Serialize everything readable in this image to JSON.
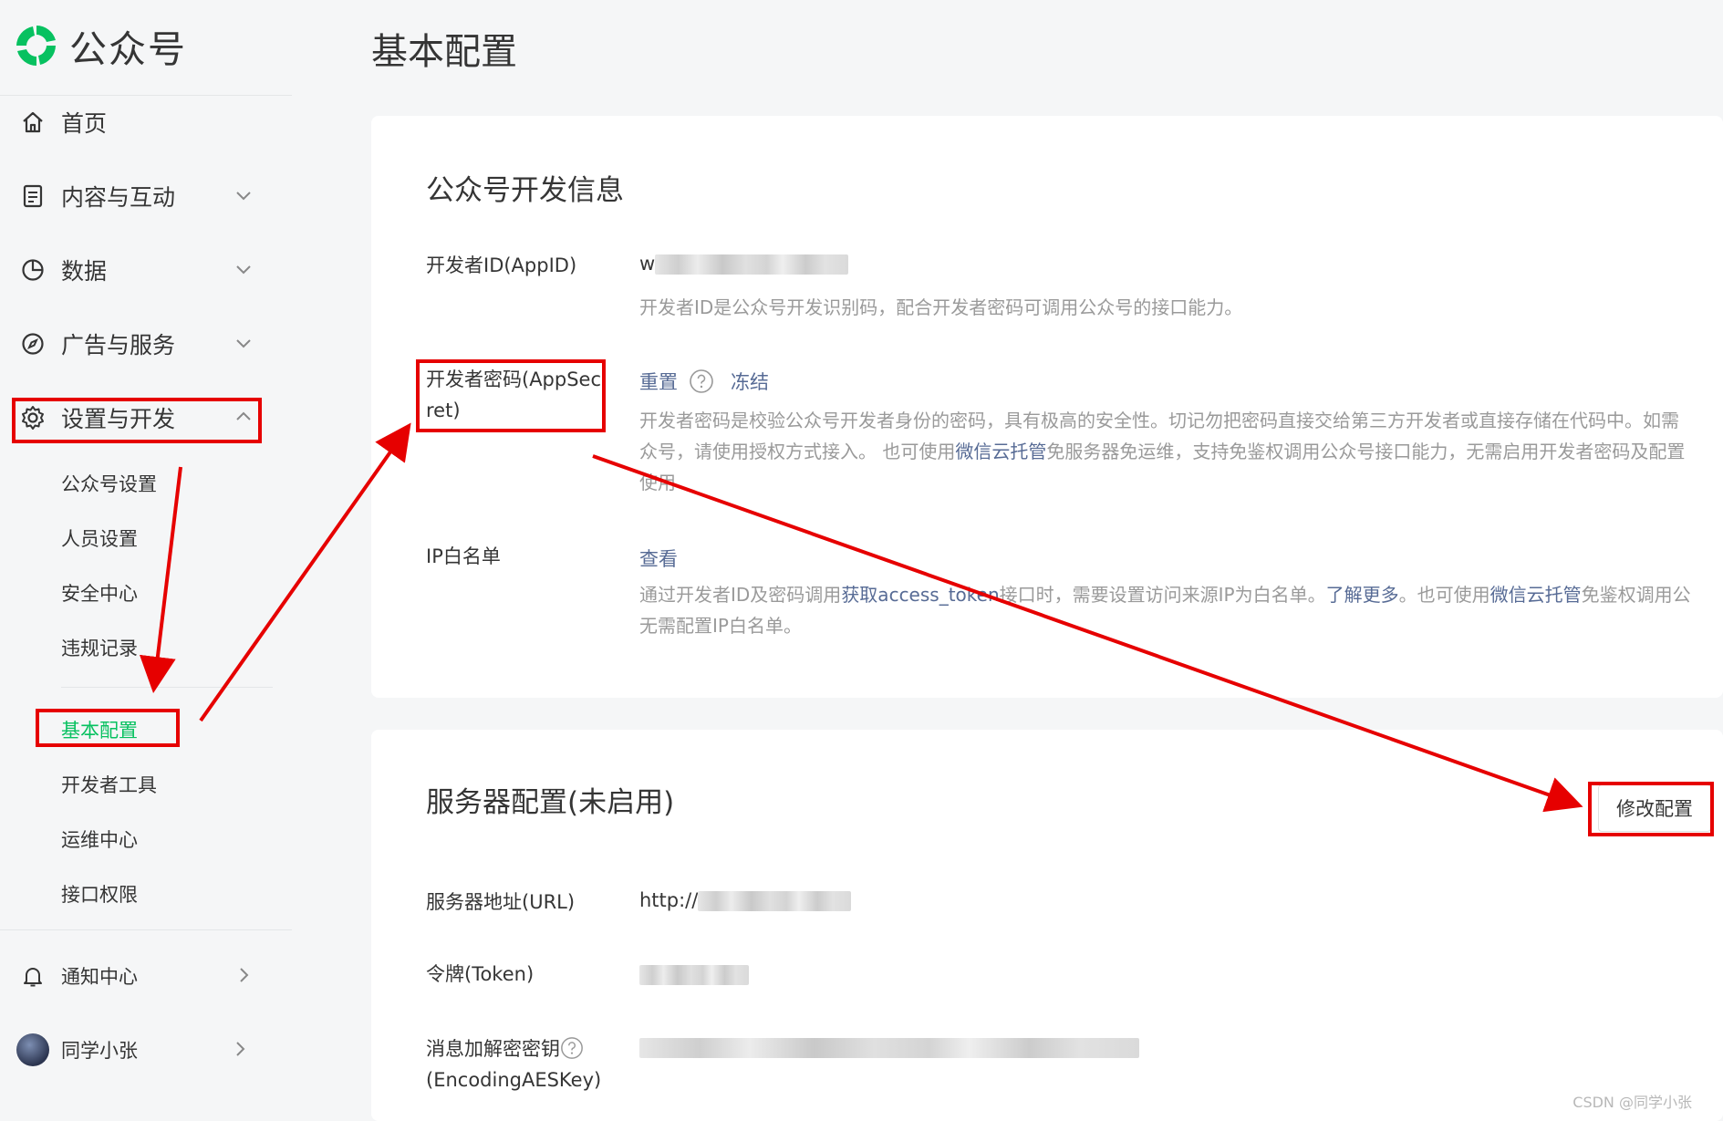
{
  "app": {
    "name": "公众号"
  },
  "sidebar": {
    "nav": [
      {
        "label": "首页",
        "icon": "home-icon"
      },
      {
        "label": "内容与互动",
        "icon": "document-icon"
      },
      {
        "label": "数据",
        "icon": "pie-chart-icon"
      },
      {
        "label": "广告与服务",
        "icon": "compass-icon"
      },
      {
        "label": "设置与开发",
        "icon": "gear-icon"
      }
    ],
    "sub_items": [
      "公众号设置",
      "人员设置",
      "安全中心",
      "违规记录",
      "基本配置",
      "开发者工具",
      "运维中心",
      "接口权限"
    ],
    "active_sub": "基本配置",
    "bottom": [
      {
        "label": "通知中心",
        "icon": "bell-icon"
      },
      {
        "label": "同学小张",
        "icon": "avatar"
      }
    ]
  },
  "main": {
    "title": "基本配置",
    "dev_info": {
      "title": "公众号开发信息",
      "appid": {
        "label": "开发者ID(AppID)",
        "value_prefix": "w",
        "desc": "开发者ID是公众号开发识别码，配合开发者密码可调用公众号的接口能力。"
      },
      "appsecret": {
        "label_line1": "开发者密码(AppSec",
        "label_line2": "ret)",
        "reset": "重置",
        "freeze": "冻结",
        "desc_line1": "开发者密码是校验公众号开发者身份的密码，具有极高的安全性。切记勿把密码直接交给第三方开发者或直接存储在代码中。如需",
        "desc_line2_a": "众号，请使用授权方式接入。 也可使用",
        "desc_line2_link": "微信云托管",
        "desc_line2_b": "免服务器免运维，支持免鉴权调用公众号接口能力，无需启用开发者密码及配置",
        "desc_line3": "使用"
      },
      "ip_whitelist": {
        "label": "IP白名单",
        "view": "查看",
        "desc_a": "通过开发者ID及密码调用",
        "desc_link1": "获取access_token",
        "desc_b": "接口时，需要设置访问来源IP为白名单。",
        "desc_link2": "了解更多",
        "desc_c": "。也可使用",
        "desc_link3": "微信云托管",
        "desc_d": "免鉴权调用公",
        "desc_line2": "无需配置IP白名单。"
      }
    },
    "server_config": {
      "title": "服务器配置(未启用)",
      "edit_button": "修改配置",
      "url": {
        "label": "服务器地址(URL)",
        "value_prefix": "http://"
      },
      "token": {
        "label": "令牌(Token)"
      },
      "aeskey": {
        "label_line1": "消息加解密密钥",
        "label_line2": "(EncodingAESKey)"
      }
    }
  },
  "watermark": "CSDN @同学小张",
  "colors": {
    "accent": "#07c160",
    "link": "#576b95",
    "annotation": "#e60000"
  }
}
